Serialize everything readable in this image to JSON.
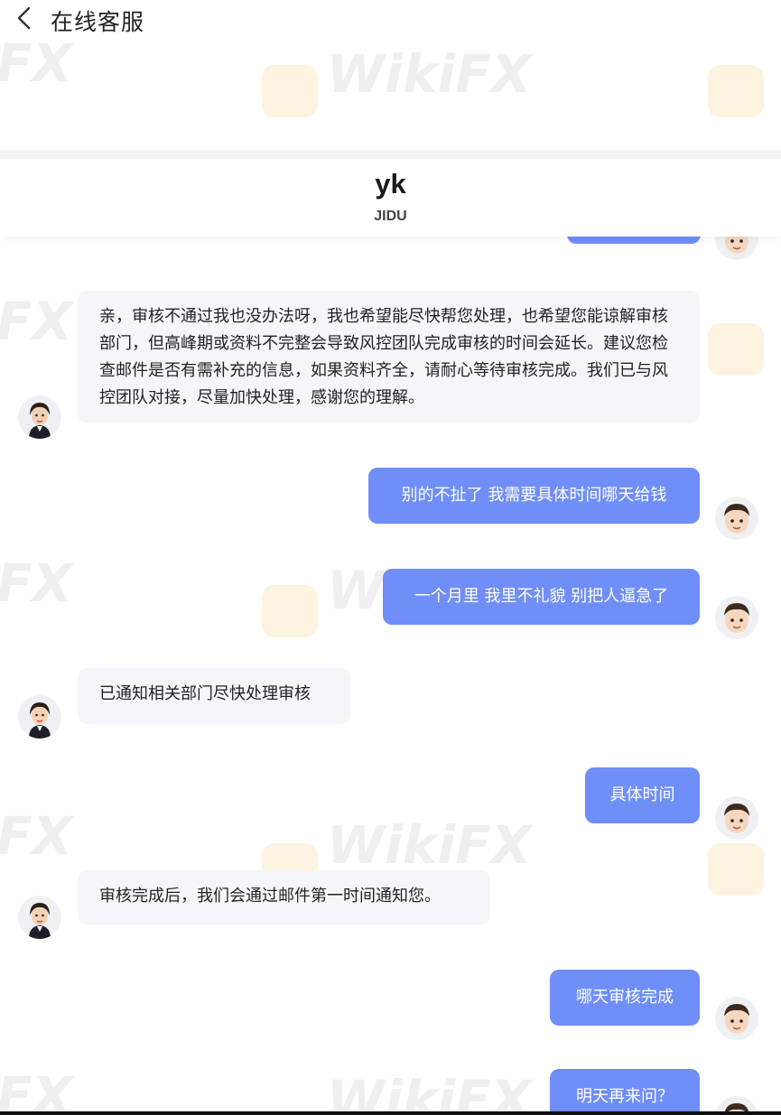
{
  "topbar": {
    "title": "在线客服",
    "back_icon": "chevron-left-icon"
  },
  "agent": {
    "name": "yk",
    "company": "JIDU"
  },
  "watermark": {
    "text": "WikiFX",
    "fragment": "FX"
  },
  "messages": [
    {
      "from": "agent",
      "text": "亲，审核不通过我也没办法呀，我也希望能尽快帮您处理，也希望您能谅解审核部门，但高峰期或资料不完整会导致风控团队完成审核的时间会延长。建议您检查邮件是否有需补充的信息，如果资料齐全，请耐心等待审核完成。我们已与风控团队对接，尽量加快处理，感谢您的理解。"
    },
    {
      "from": "user",
      "text": "别的不扯了 我需要具体时间哪天给钱"
    },
    {
      "from": "user",
      "text": "一个月里 我里不礼貌 别把人逼急了"
    },
    {
      "from": "agent",
      "text": "已通知相关部门尽快处理审核"
    },
    {
      "from": "user",
      "text": "具体时间"
    },
    {
      "from": "agent",
      "text": "审核完成后，我们会通过邮件第一时间通知您。"
    },
    {
      "from": "user",
      "text": "哪天审核完成"
    },
    {
      "from": "user",
      "text": "明天再来问？"
    }
  ],
  "colors": {
    "user_bubble": "#6f8ef7",
    "agent_bubble": "#f5f6fa"
  }
}
